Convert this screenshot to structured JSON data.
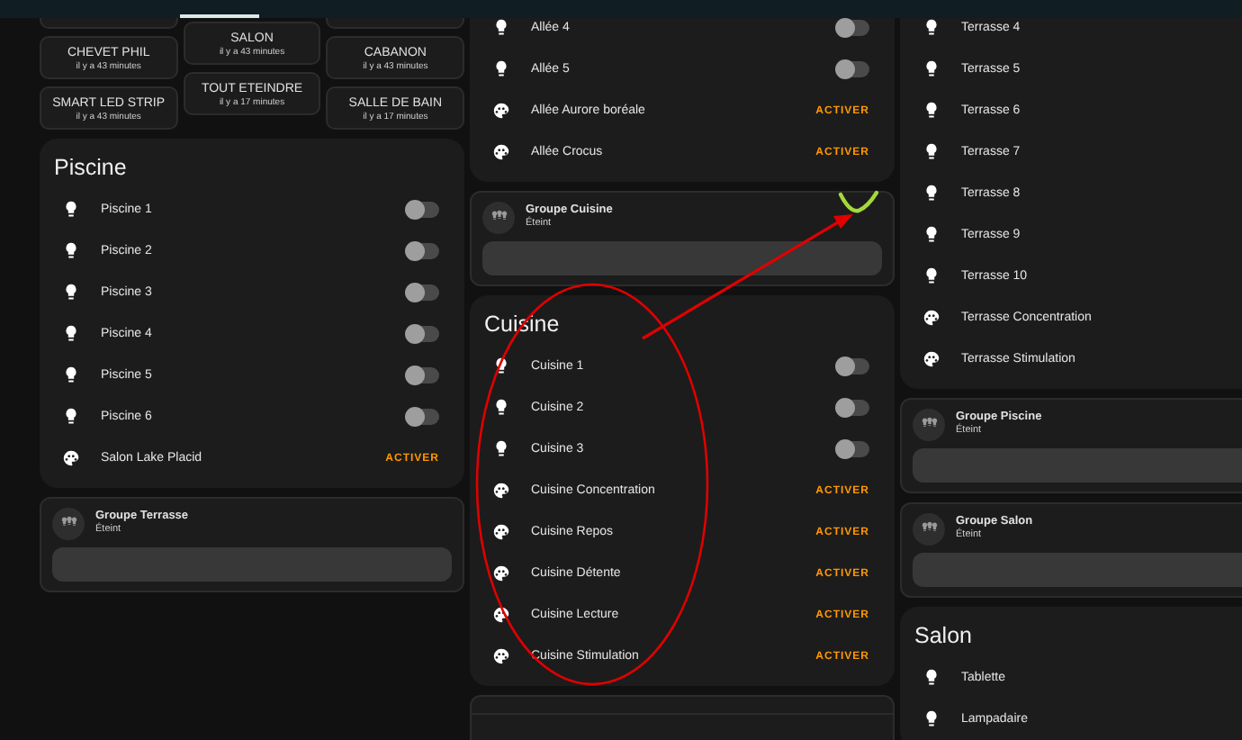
{
  "columns": [
    {
      "cards": [
        {
          "kind": "scenes",
          "button_columns": [
            [
              {
                "kind": "partial"
              },
              {
                "kind": "scene",
                "name": "CHEVET PHIL",
                "time": "il y a 43 minutes"
              },
              {
                "kind": "scene",
                "name": "SMART LED STRIP",
                "time": "il y a 43 minutes"
              }
            ],
            [
              {
                "kind": "scene",
                "name": "SALON",
                "time": "il y a 43 minutes"
              },
              {
                "kind": "scene",
                "name": "TOUT ETEINDRE",
                "time": "il y a 17 minutes"
              }
            ],
            [
              {
                "kind": "partial"
              },
              {
                "kind": "scene",
                "name": "CABANON",
                "time": "il y a 43 minutes"
              },
              {
                "kind": "scene",
                "name": "SALLE DE BAIN",
                "time": "il y a 17 minutes"
              }
            ]
          ]
        },
        {
          "kind": "entities",
          "title": "Piscine",
          "rows": [
            {
              "kind": "light",
              "name": "Piscine 1",
              "on": false
            },
            {
              "kind": "light",
              "name": "Piscine 2",
              "on": false
            },
            {
              "kind": "light",
              "name": "Piscine 3",
              "on": false
            },
            {
              "kind": "light",
              "name": "Piscine 4",
              "on": false
            },
            {
              "kind": "light",
              "name": "Piscine 5",
              "on": false
            },
            {
              "kind": "light",
              "name": "Piscine 6",
              "on": false
            },
            {
              "kind": "scene",
              "name": "Salon Lake Placid",
              "action": "ACTIVER"
            }
          ]
        },
        {
          "kind": "group",
          "name": "Groupe Terrasse",
          "state": "Éteint",
          "level": 0
        }
      ]
    },
    {
      "cards": [
        {
          "kind": "entities",
          "rows": [
            {
              "kind": "light",
              "name": "Allée 4",
              "on": false
            },
            {
              "kind": "light",
              "name": "Allée 5",
              "on": false
            },
            {
              "kind": "scene",
              "name": "Allée Aurore boréale",
              "action": "ACTIVER"
            },
            {
              "kind": "scene",
              "name": "Allée Crocus",
              "action": "ACTIVER"
            }
          ]
        },
        {
          "kind": "group",
          "name": "Groupe Cuisine",
          "state": "Éteint",
          "level": 0
        },
        {
          "kind": "entities",
          "title": "Cuisine",
          "rows": [
            {
              "kind": "light",
              "name": "Cuisine 1",
              "on": false
            },
            {
              "kind": "light",
              "name": "Cuisine 2",
              "on": false
            },
            {
              "kind": "light",
              "name": "Cuisine 3",
              "on": false
            },
            {
              "kind": "scene",
              "name": "Cuisine Concentration",
              "action": "ACTIVER"
            },
            {
              "kind": "scene",
              "name": "Cuisine Repos",
              "action": "ACTIVER"
            },
            {
              "kind": "scene",
              "name": "Cuisine Détente",
              "action": "ACTIVER"
            },
            {
              "kind": "scene",
              "name": "Cuisine Lecture",
              "action": "ACTIVER"
            },
            {
              "kind": "scene",
              "name": "Cuisine Stimulation",
              "action": "ACTIVER"
            }
          ]
        },
        {
          "kind": "partial"
        }
      ]
    },
    {
      "cards": [
        {
          "kind": "entities",
          "rows": [
            {
              "kind": "light_no_toggle",
              "name": "Terrasse 4"
            },
            {
              "kind": "light_no_toggle",
              "name": "Terrasse 5"
            },
            {
              "kind": "light_no_toggle",
              "name": "Terrasse 6"
            },
            {
              "kind": "light_no_toggle",
              "name": "Terrasse 7"
            },
            {
              "kind": "light_no_toggle",
              "name": "Terrasse 8"
            },
            {
              "kind": "light_no_toggle",
              "name": "Terrasse 9"
            },
            {
              "kind": "light_no_toggle",
              "name": "Terrasse 10"
            },
            {
              "kind": "scene_no_action",
              "name": "Terrasse Concentration"
            },
            {
              "kind": "scene_no_action",
              "name": "Terrasse Stimulation"
            }
          ]
        },
        {
          "kind": "group",
          "name": "Groupe Piscine",
          "state": "Éteint",
          "level": 0
        },
        {
          "kind": "group",
          "name": "Groupe Salon",
          "state": "Éteint",
          "level": 0
        },
        {
          "kind": "entities",
          "title": "Salon",
          "rows": [
            {
              "kind": "light_no_toggle",
              "name": "Tablette"
            },
            {
              "kind": "light_no_toggle",
              "name": "Lampadaire"
            }
          ]
        }
      ]
    }
  ],
  "annotations": [
    {
      "kind": "ellipse",
      "color": "#e00000"
    },
    {
      "kind": "arrow",
      "color": "#e00000"
    },
    {
      "kind": "check",
      "color": "#a4d83a"
    }
  ]
}
